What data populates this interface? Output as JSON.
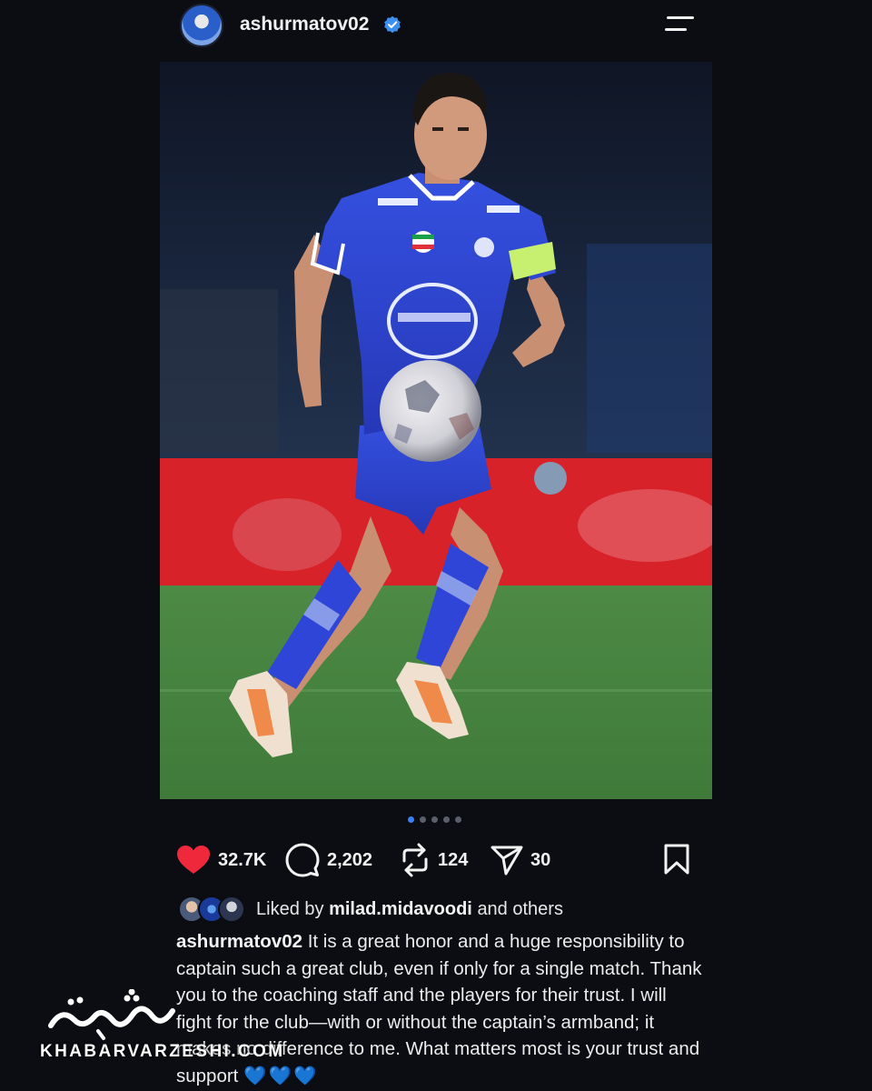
{
  "post": {
    "username": "ashurmatov02",
    "verified": true,
    "image_alt": "Football player in blue Esteghlal kit running with ball",
    "carousel": {
      "total": 5,
      "active_index": 1
    },
    "actions": {
      "likes": "32.7K",
      "comments": "2,202",
      "reposts": "124",
      "shares": "30"
    },
    "liked_by": {
      "prefix": "Liked by",
      "user": "milad.midavoodi",
      "suffix": "and others"
    },
    "caption": {
      "author": "ashurmatov02",
      "text": "It is a great honor and a huge responsibility to captain such a great club, even if only for a single match. Thank you to the coaching staff and the players for their trust. I will fight for the club—with or without the captain’s armband; it makes no difference to me. What matters most is your trust and support",
      "emojis": "💙💙💙"
    }
  },
  "watermark": {
    "brand_latin": "KHABARVARZESHI.COM"
  },
  "colors": {
    "background": "#0b0d13",
    "like_red": "#f0283c",
    "accent_blue": "#3d7ff5",
    "kit_blue": "#2f46d6"
  }
}
